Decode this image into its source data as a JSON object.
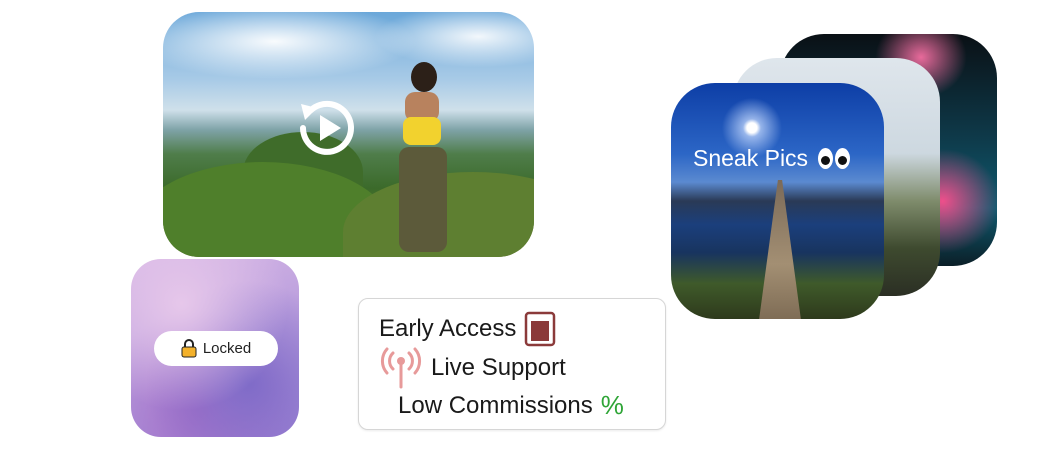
{
  "locked": {
    "label": "Locked"
  },
  "features": [
    {
      "label": "Early Access"
    },
    {
      "label": "Live Support"
    },
    {
      "label": "Low Commissions",
      "suffix": "%"
    }
  ],
  "stack": {
    "label": "Sneak Pics"
  },
  "icons": {
    "replay": "replay-play-icon",
    "lock": "lock-icon",
    "early_access": "book-icon",
    "live_support": "broadcast-icon",
    "sneak": "eyes-icon"
  },
  "colors": {
    "percent": "#2fa537",
    "book": "#8b3a3a",
    "broadcast": "#e79a9a",
    "lock": "#f3b12b"
  }
}
